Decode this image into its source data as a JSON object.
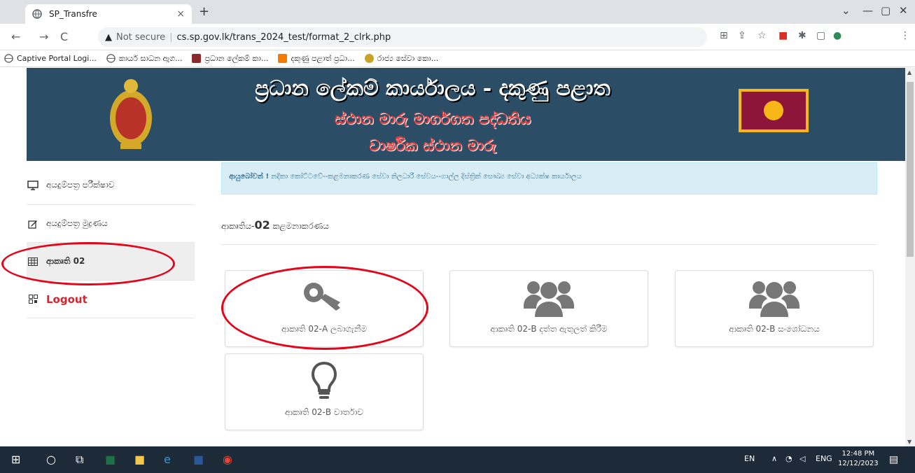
{
  "browser": {
    "tab_title": "SP_Transfre",
    "tab_close": "×",
    "new_tab": "+",
    "window_minimize": "—",
    "window_maximize": "▢",
    "window_close": "✕",
    "window_menu": "⌄",
    "address_warning": "Not secure",
    "address_separator": "|",
    "url": "cs.sp.gov.lk/trans_2024_test/format_2_clrk.php",
    "bookmarks": [
      "Captive Portal Logi...",
      "කාර්ය සාධන ඇග...",
      "ප්‍රධාන ලේකම් කා...",
      "දකුණු පළාත් ප්‍රධා...",
      "රාජ්‍ය සේවා කො..."
    ]
  },
  "banner": {
    "line1": "ප්‍රධාන ලේකම් කාර්යාලය - දකුණු පළාත",
    "line2": "ස්ථාන මාරු මාර්ගගත පද්ධතිය",
    "line3": "වාර්ෂික ස්ථාන මාරු"
  },
  "sidebar": {
    "items": [
      {
        "label": "අයදුම්පත්‍ර පරීක්ෂාව",
        "icon": "monitor-icon"
      },
      {
        "label": "අයදුම්පත්‍ර මුද්‍රණය",
        "icon": "edit-icon"
      },
      {
        "label": "ආකෘති 02",
        "icon": "table-icon"
      },
      {
        "label": "Logout",
        "icon": "qr-icon"
      }
    ]
  },
  "main": {
    "alert_bold": "ආයුබෝවන් !",
    "alert_text": "නදිකා කෝට්ටවේ--කළමනාකරණ සේවා නිලධාරී සේවය--ගාල්ල දිස්ත්‍රික් සෞඛ්‍ය සේවා අධ්‍යක්ෂ කාර්යාලය",
    "subhead_prefix": "ආකෘතිය-",
    "subhead_bold": "02",
    "subhead_suffix": " කළමනාකරණය",
    "cards": [
      {
        "label": "ආකෘති 02-A ලබාගැනීම",
        "icon": "key-icon"
      },
      {
        "label": "ආකෘති 02-B දත්ත ඇතුලත් කිරීම",
        "icon": "users-icon"
      },
      {
        "label": "ආකෘති 02-B සංශෝධනය",
        "icon": "users-icon"
      },
      {
        "label": "ආකෘති 02-B වාර්තාව",
        "icon": "lightbulb-icon"
      }
    ]
  },
  "taskbar": {
    "lang_short": "EN",
    "lang": "ENG",
    "time": "12:48 PM",
    "date": "12/12/2023"
  },
  "colors": {
    "banner_bg": "#2b4d66",
    "alert_bg": "#d9edf7",
    "logout": "#d9232d",
    "annotation_ring": "#e3061b"
  }
}
